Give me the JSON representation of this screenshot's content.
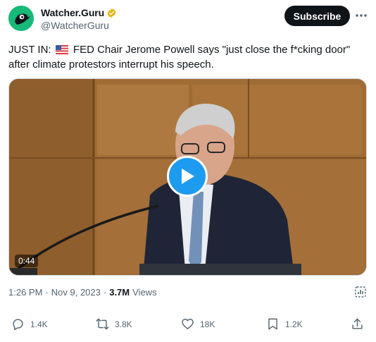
{
  "author": {
    "display_name": "Watcher.Guru",
    "handle": "@WatcherGuru",
    "verified": true,
    "verified_color": "#e2b719",
    "avatar_color": "#17b978"
  },
  "header": {
    "subscribe_label": "Subscribe",
    "more_icon": "more-dots-icon"
  },
  "tweet": {
    "text_prefix": "JUST IN: ",
    "flag_icon": "us-flag-icon",
    "text_main": " FED Chair Jerome Powell says \"just close the f*cking door\" after climate protestors interrupt his speech."
  },
  "media": {
    "type": "video",
    "duration": "0:44",
    "play_icon": "play-icon",
    "accent": "#1d9bf0"
  },
  "meta": {
    "time": "1:26 PM",
    "separator": "·",
    "date": "Nov 9, 2023",
    "separator2": "·",
    "views_count": "3.7M",
    "views_label": "Views"
  },
  "actions": {
    "reply_count": "1.4K",
    "retweet_count": "3.8K",
    "like_count": "18K",
    "bookmark_count": "1.2K"
  }
}
